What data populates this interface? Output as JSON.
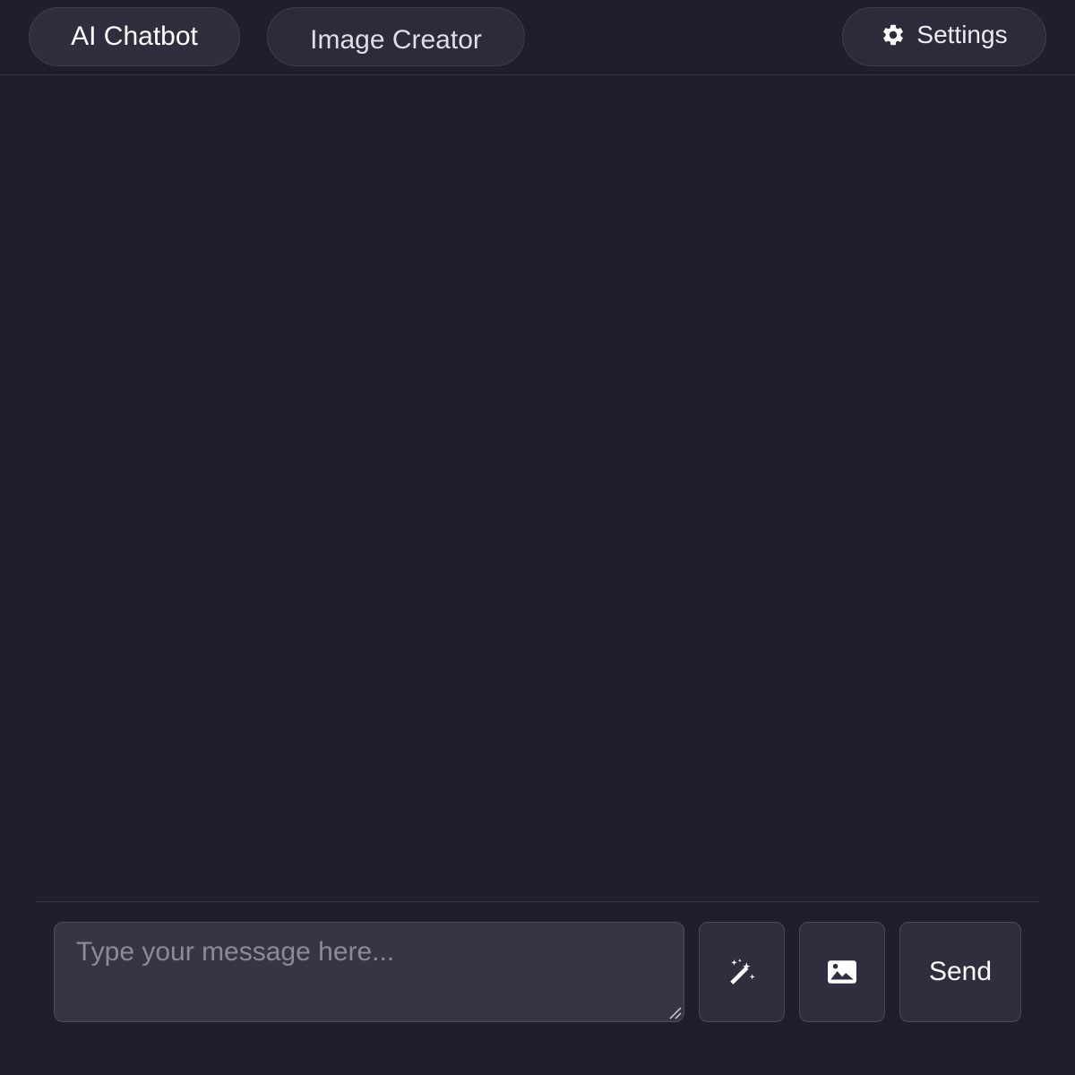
{
  "nav": {
    "tabs": [
      {
        "label": "AI Chatbot",
        "active": true
      },
      {
        "label": "Image Creator",
        "active": false
      }
    ],
    "settings_label": "Settings",
    "settings_icon": "gear-icon"
  },
  "composer": {
    "placeholder": "Type your message here...",
    "value": "",
    "magic_icon": "magic-wand-icon",
    "image_icon": "image-icon",
    "send_label": "Send"
  },
  "colors": {
    "background": "#1f1e2e",
    "pill_bg": "#2c2b3b",
    "input_bg": "#363544",
    "border": "#4b4a59",
    "text": "#ececf1",
    "placeholder": "#8b8a96"
  }
}
